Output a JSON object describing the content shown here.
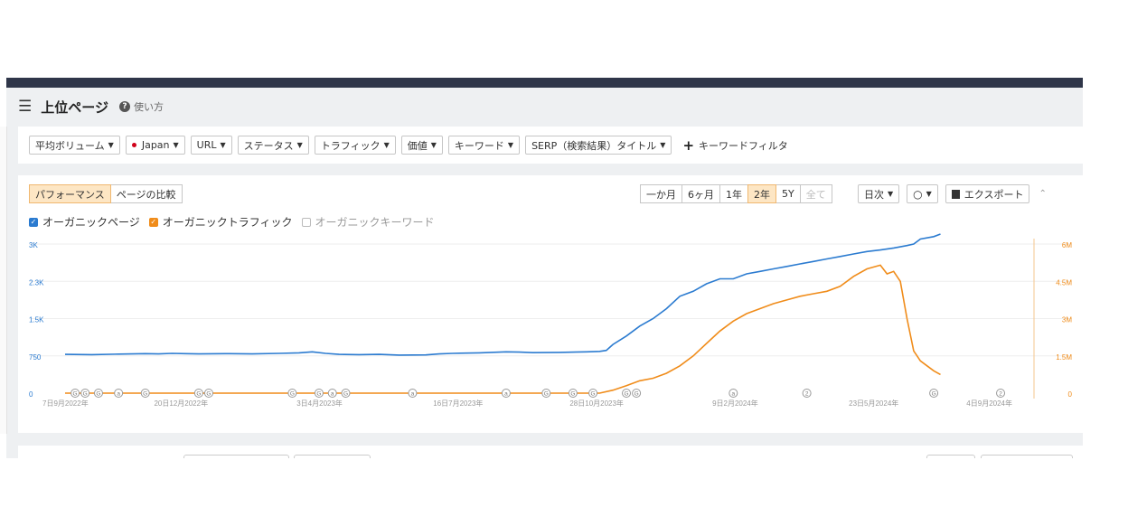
{
  "header": {
    "title": "上位ページ",
    "help_label": "使い方"
  },
  "filters": [
    {
      "label": "平均ボリューム",
      "caret": true
    },
    {
      "label": "Japan",
      "caret": true,
      "dot": true
    },
    {
      "label": "URL",
      "caret": true
    },
    {
      "label": "ステータス",
      "caret": true
    },
    {
      "label": "トラフィック",
      "caret": true
    },
    {
      "label": "価値",
      "caret": true
    },
    {
      "label": "キーワード",
      "caret": true
    },
    {
      "label": "SERP（検索結果）タイトル",
      "caret": true
    }
  ],
  "keyword_filter_label": "キーワードフィルタ",
  "mode_toggle": [
    {
      "label": "パフォーマンス",
      "active": true
    },
    {
      "label": "ページの比較",
      "active": false
    }
  ],
  "range_buttons": [
    {
      "label": "一か月",
      "state": "normal"
    },
    {
      "label": "6ヶ月",
      "state": "normal"
    },
    {
      "label": "1年",
      "state": "normal"
    },
    {
      "label": "2年",
      "state": "active"
    },
    {
      "label": "5Y",
      "state": "normal"
    },
    {
      "label": "全て",
      "state": "disabled"
    }
  ],
  "interval_label": "日次",
  "export_label": "エクスポート",
  "legend": [
    {
      "label": "オーガニックページ",
      "checked": true,
      "color": "#2b7bd0"
    },
    {
      "label": "オーガニックトラフィック",
      "checked": true,
      "color": "#f08c1a"
    },
    {
      "label": "オーガニックキーワード",
      "checked": false,
      "color": "#999999"
    }
  ],
  "chart_data": {
    "type": "line",
    "x_labels": [
      "7日9月2022年",
      "20日12月2022年",
      "3日4月2023年",
      "16日7月2023年",
      "28日10月2023年",
      "9日2月2024年",
      "23日5月2024年",
      "4日9月2024年"
    ],
    "left_axis": {
      "ticks": [
        "0",
        "750",
        "1.5K",
        "2.3K",
        "3K"
      ],
      "range": [
        0,
        3000
      ],
      "color": "#2b7bd0"
    },
    "right_axis": {
      "ticks": [
        "0",
        "1.5M",
        "3M",
        "4.5M",
        "6M"
      ],
      "range": [
        0,
        6000000
      ],
      "color": "#f08c1a"
    },
    "grid": true,
    "series": [
      {
        "color": "#2b7bd0",
        "axis": "left",
        "points": [
          [
            0,
            780
          ],
          [
            4,
            775
          ],
          [
            8,
            785
          ],
          [
            12,
            795
          ],
          [
            14,
            790
          ],
          [
            16,
            800
          ],
          [
            18,
            795
          ],
          [
            20,
            790
          ],
          [
            24,
            795
          ],
          [
            28,
            790
          ],
          [
            32,
            800
          ],
          [
            35,
            810
          ],
          [
            37,
            830
          ],
          [
            39,
            800
          ],
          [
            41,
            780
          ],
          [
            44,
            775
          ],
          [
            47,
            780
          ],
          [
            50,
            765
          ],
          [
            54,
            770
          ],
          [
            56,
            790
          ],
          [
            58,
            800
          ],
          [
            62,
            810
          ],
          [
            66,
            830
          ],
          [
            68,
            825
          ],
          [
            70,
            815
          ],
          [
            74,
            820
          ],
          [
            78,
            830
          ],
          [
            80,
            840
          ],
          [
            81,
            860
          ],
          [
            82,
            980
          ],
          [
            84,
            1150
          ],
          [
            86,
            1350
          ],
          [
            88,
            1500
          ],
          [
            90,
            1700
          ],
          [
            92,
            1950
          ],
          [
            94,
            2050
          ],
          [
            96,
            2200
          ],
          [
            98,
            2300
          ],
          [
            100,
            2300
          ],
          [
            102,
            2400
          ],
          [
            104,
            2450
          ],
          [
            106,
            2500
          ],
          [
            108,
            2550
          ],
          [
            110,
            2600
          ],
          [
            112,
            2650
          ],
          [
            114,
            2700
          ],
          [
            116,
            2750
          ],
          [
            118,
            2800
          ],
          [
            120,
            2850
          ],
          [
            122,
            2880
          ],
          [
            124,
            2920
          ],
          [
            126,
            2970
          ],
          [
            127,
            3000
          ],
          [
            128,
            3100
          ],
          [
            130,
            3150
          ],
          [
            131,
            3200
          ]
        ]
      },
      {
        "color": "#f08c1a",
        "axis": "right",
        "points": [
          [
            0,
            0
          ],
          [
            10,
            0
          ],
          [
            20,
            0
          ],
          [
            30,
            0
          ],
          [
            40,
            0
          ],
          [
            50,
            0
          ],
          [
            60,
            0
          ],
          [
            70,
            0
          ],
          [
            78,
            0
          ],
          [
            80,
            0
          ],
          [
            82,
            120000
          ],
          [
            84,
            300000
          ],
          [
            86,
            500000
          ],
          [
            88,
            600000
          ],
          [
            90,
            800000
          ],
          [
            92,
            1100000
          ],
          [
            94,
            1500000
          ],
          [
            96,
            2000000
          ],
          [
            98,
            2500000
          ],
          [
            100,
            2900000
          ],
          [
            102,
            3200000
          ],
          [
            104,
            3400000
          ],
          [
            106,
            3600000
          ],
          [
            108,
            3750000
          ],
          [
            110,
            3900000
          ],
          [
            112,
            4000000
          ],
          [
            114,
            4100000
          ],
          [
            116,
            4300000
          ],
          [
            118,
            4700000
          ],
          [
            120,
            5000000
          ],
          [
            122,
            5150000
          ],
          [
            123,
            4800000
          ],
          [
            124,
            4900000
          ],
          [
            125,
            4500000
          ],
          [
            126,
            3000000
          ],
          [
            127,
            1700000
          ],
          [
            128,
            1300000
          ],
          [
            129,
            1100000
          ],
          [
            130,
            900000
          ],
          [
            131,
            750000
          ]
        ]
      }
    ],
    "annotations": [
      {
        "x": 1.5,
        "label": "G"
      },
      {
        "x": 3,
        "label": "G"
      },
      {
        "x": 5,
        "label": "G"
      },
      {
        "x": 8,
        "label": "a"
      },
      {
        "x": 12,
        "label": "G"
      },
      {
        "x": 20,
        "label": "G"
      },
      {
        "x": 21.5,
        "label": "G"
      },
      {
        "x": 34,
        "label": "G"
      },
      {
        "x": 38,
        "label": "G"
      },
      {
        "x": 40,
        "label": "a"
      },
      {
        "x": 42,
        "label": "G"
      },
      {
        "x": 52,
        "label": "a"
      },
      {
        "x": 66,
        "label": "a"
      },
      {
        "x": 72,
        "label": "G"
      },
      {
        "x": 76,
        "label": "G"
      },
      {
        "x": 79,
        "label": "G"
      },
      {
        "x": 84,
        "label": "G"
      },
      {
        "x": 85.5,
        "label": "G"
      },
      {
        "x": 100,
        "label": "a"
      },
      {
        "x": 111,
        "label": "2"
      },
      {
        "x": 130,
        "label": "G"
      },
      {
        "x": 140,
        "label": "2"
      }
    ],
    "x_max": 145
  }
}
